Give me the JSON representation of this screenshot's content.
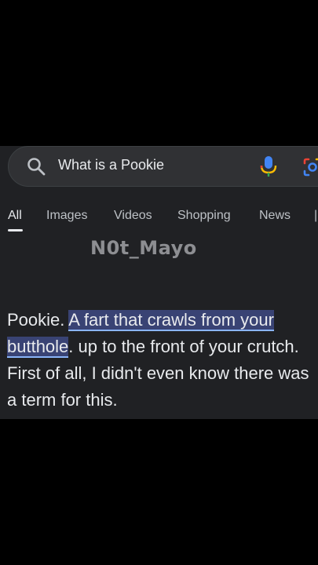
{
  "search": {
    "query": "What is a Pookie"
  },
  "tabs": [
    {
      "label": "All",
      "active": true
    },
    {
      "label": "Images"
    },
    {
      "label": "Videos"
    },
    {
      "label": "Shopping"
    },
    {
      "label": "News"
    }
  ],
  "watermark": "N0t_Mayo",
  "snippet": {
    "term": "Pookie.",
    "highlighted": "A fart that crawls from your butthole",
    "rest": ". up to the front of your crutch. First of all, I didn't even know there was a term for this."
  },
  "icons": {
    "search": "search-icon",
    "mic": "microphone-icon",
    "lens": "google-lens-icon"
  },
  "colors": {
    "background": "#000000",
    "panel": "#202124",
    "search_bar": "#303134",
    "highlight": "#394374",
    "text": "#e8eaed"
  }
}
